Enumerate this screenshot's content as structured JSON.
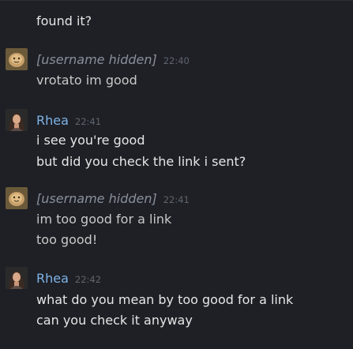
{
  "chat": {
    "top_fragment": "found it?",
    "messages": [
      {
        "author": "[username hidden]",
        "time": "22:40",
        "lines": [
          "vrotato im good"
        ]
      },
      {
        "author": "Rhea",
        "time": "22:41",
        "lines": [
          "i see you're good",
          "but did you check the link i sent?"
        ]
      },
      {
        "author": "[username hidden]",
        "time": "22:41",
        "lines": [
          "im too good for a link",
          "too good!"
        ]
      },
      {
        "author": "Rhea",
        "time": "22:42",
        "lines": [
          "what do you mean by too good for a link",
          "can you check it anyway"
        ]
      }
    ]
  },
  "colors": {
    "background": "#1e2026",
    "author_name": "#7fb3e6",
    "timestamp": "#5f646d",
    "message_text": "#e6e6e6"
  },
  "icons": {
    "avatar_1": "potato-avatar-icon",
    "avatar_2": "woman-portrait-avatar-icon"
  }
}
